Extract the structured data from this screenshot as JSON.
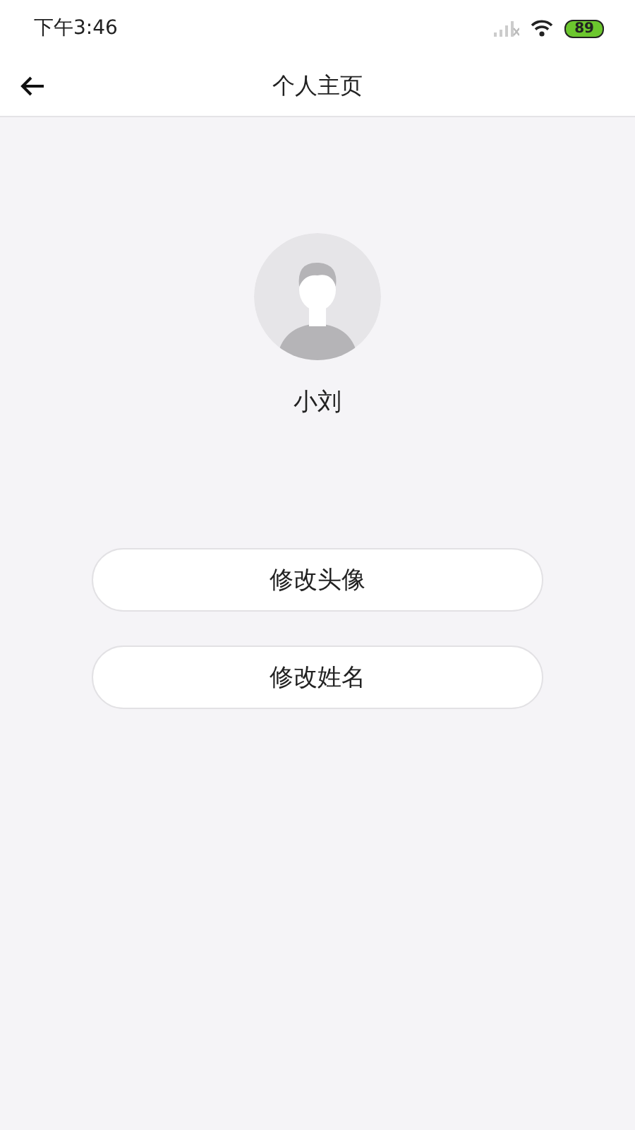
{
  "status_bar": {
    "time": "下午3:46",
    "battery": "89"
  },
  "nav": {
    "title": "个人主页"
  },
  "profile": {
    "name": "小刘"
  },
  "buttons": [
    {
      "label": "修改头像"
    },
    {
      "label": "修改姓名"
    }
  ]
}
